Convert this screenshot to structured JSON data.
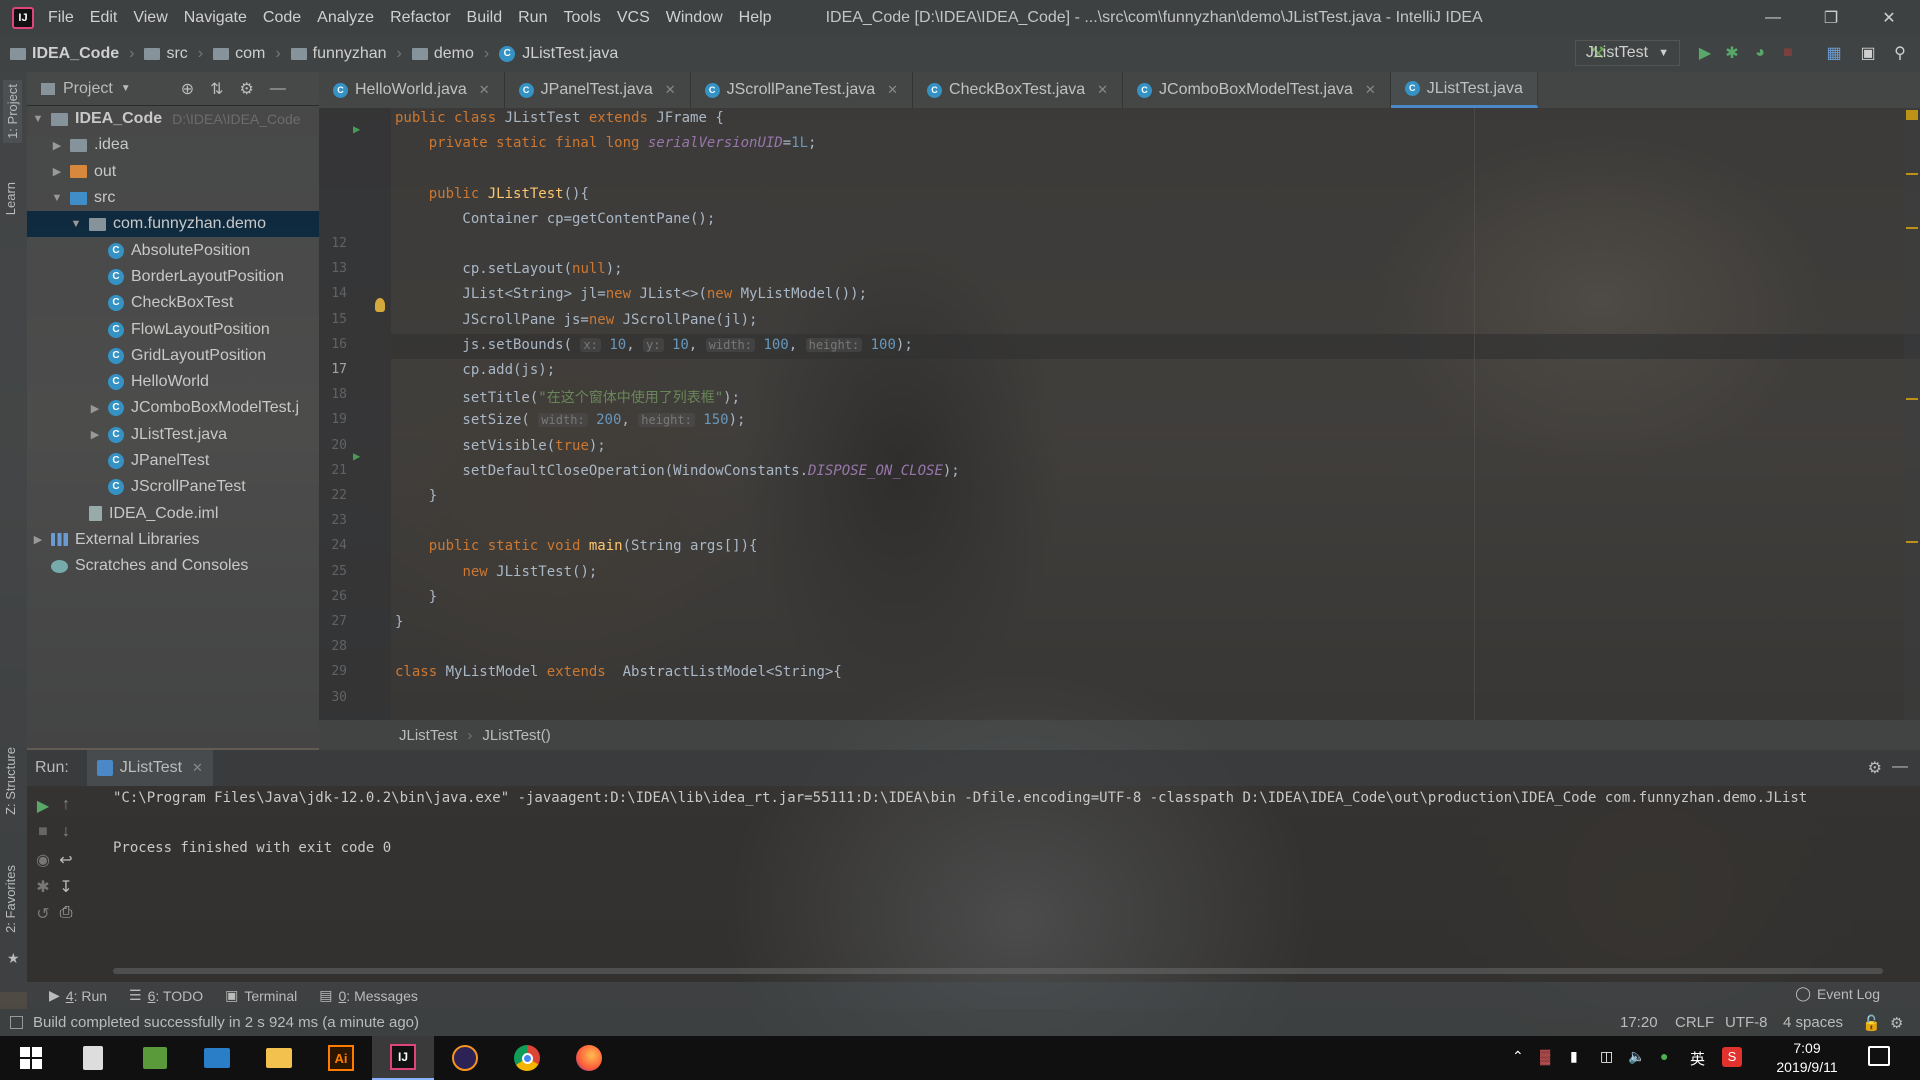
{
  "app": {
    "window_title": "IDEA_Code [D:\\IDEA\\IDEA_Code] - ...\\src\\com\\funnyzhan\\demo\\JListTest.java - IntelliJ IDEA"
  },
  "menu": [
    "File",
    "Edit",
    "View",
    "Navigate",
    "Code",
    "Analyze",
    "Refactor",
    "Build",
    "Run",
    "Tools",
    "VCS",
    "Window",
    "Help"
  ],
  "breadcrumb": [
    "IDEA_Code",
    "src",
    "com",
    "funnyzhan",
    "demo",
    "JListTest.java"
  ],
  "run_config": "JListTest",
  "left_strip": {
    "project": "1: Project",
    "learn": "Learn",
    "structure": "Z: Structure",
    "favorites": "2: Favorites"
  },
  "project_pane": {
    "title": "Project",
    "items": [
      {
        "label": "IDEA_Code",
        "hint": "D:\\IDEA\\IDEA_Code",
        "type": "module",
        "depth": 0,
        "expanded": true
      },
      {
        "label": ".idea",
        "type": "folder",
        "depth": 1,
        "expanded": false
      },
      {
        "label": "out",
        "type": "folder-orange",
        "depth": 1,
        "expanded": false
      },
      {
        "label": "src",
        "type": "folder-blue",
        "depth": 1,
        "expanded": true
      },
      {
        "label": "com.funnyzhan.demo",
        "type": "package",
        "depth": 2,
        "expanded": true,
        "selected": true
      },
      {
        "label": "AbsolutePosition",
        "type": "class",
        "depth": 3
      },
      {
        "label": "BorderLayoutPosition",
        "type": "class",
        "depth": 3
      },
      {
        "label": "CheckBoxTest",
        "type": "class",
        "depth": 3
      },
      {
        "label": "FlowLayoutPosition",
        "type": "class",
        "depth": 3
      },
      {
        "label": "GridLayoutPosition",
        "type": "class",
        "depth": 3
      },
      {
        "label": "HelloWorld",
        "type": "class",
        "depth": 3
      },
      {
        "label": "JComboBoxModelTest.j",
        "type": "class",
        "depth": 3,
        "collapsed": true
      },
      {
        "label": "JListTest.java",
        "type": "class",
        "depth": 3,
        "collapsed": true
      },
      {
        "label": "JPanelTest",
        "type": "class",
        "depth": 3
      },
      {
        "label": "JScrollPaneTest",
        "type": "class",
        "depth": 3
      },
      {
        "label": "IDEA_Code.iml",
        "type": "iml",
        "depth": 2
      },
      {
        "label": "External Libraries",
        "type": "lib",
        "depth": 0,
        "collapsed": true
      },
      {
        "label": "Scratches and Consoles",
        "type": "scratch",
        "depth": 0
      }
    ]
  },
  "tabs": [
    {
      "label": "HelloWorld.java",
      "active": false
    },
    {
      "label": "JPanelTest.java",
      "active": false
    },
    {
      "label": "JScrollPaneTest.java",
      "active": false
    },
    {
      "label": "CheckBoxTest.java",
      "active": false
    },
    {
      "label": "JComboBoxModelTest.java",
      "active": false
    },
    {
      "label": "JListTest.java",
      "active": true
    }
  ],
  "editor": {
    "current_line": 17,
    "lines": [
      {
        "n": "",
        "html": "<span class='kw'>public class</span> JListTest <span class='kw'>extends</span> JFrame {",
        "indent": 0
      },
      {
        "n": "",
        "html": "    <span class='kw'>private static final long</span> <span class='fld'>serialVersionUID</span>=<span class='num'>1L</span>;",
        "indent": 0
      },
      {
        "n": "",
        "html": "",
        "indent": 0
      },
      {
        "n": "",
        "html": "    <span class='kw'>public</span> <span class='fn'>JListTest</span>(){",
        "indent": 0
      },
      {
        "n": "",
        "html": "        Container cp=getContentPane();",
        "indent": 0
      },
      {
        "n": "12",
        "html": "",
        "indent": 0
      },
      {
        "n": "13",
        "html": "        cp.setLayout(<span class='kw'>null</span>);",
        "indent": 0
      },
      {
        "n": "14",
        "html": "        JList&lt;String&gt; jl=<span class='kw'>new</span> JList&lt;&gt;(<span class='kw'>new</span> MyListModel());",
        "indent": 0
      },
      {
        "n": "15",
        "html": "        JScrollPane js=<span class='kw'>new</span> JScrollPane(jl);",
        "indent": 0
      },
      {
        "n": "16",
        "html": "        js.setBounds( <span class='hint'>x:</span> <span class='num'>10</span>, <span class='hint'>y:</span> <span class='num'>10</span>, <span class='hint'>width:</span> <span class='num'>100</span>, <span class='hint'>height:</span> <span class='num'>100</span>);",
        "indent": 0
      },
      {
        "n": "17",
        "html": "        cp.add(js);",
        "indent": 0
      },
      {
        "n": "18",
        "html": "        setTitle(<span class='str'>\"在这个窗体中使用了列表框\"</span>);",
        "indent": 0
      },
      {
        "n": "19",
        "html": "        setSize( <span class='hint'>width:</span> <span class='num'>200</span>, <span class='hint'>height:</span> <span class='num'>150</span>);",
        "indent": 0
      },
      {
        "n": "20",
        "html": "        setVisible(<span class='kw'>true</span>);",
        "indent": 0
      },
      {
        "n": "21",
        "html": "        setDefaultCloseOperation(WindowConstants.<span class='fld'>DISPOSE_ON_CLOSE</span>);",
        "indent": 0
      },
      {
        "n": "22",
        "html": "    }",
        "indent": 0
      },
      {
        "n": "23",
        "html": "",
        "indent": 0
      },
      {
        "n": "24",
        "html": "    <span class='kw'>public static void</span> <span class='fn'>main</span>(String args[]){",
        "indent": 0
      },
      {
        "n": "25",
        "html": "        <span class='kw'>new</span> JListTest();",
        "indent": 0
      },
      {
        "n": "26",
        "html": "    }",
        "indent": 0
      },
      {
        "n": "27",
        "html": "}",
        "indent": 0
      },
      {
        "n": "28",
        "html": "",
        "indent": 0
      },
      {
        "n": "29",
        "html": "<span class='kw'>class</span> MyListModel <span class='kw'>extends</span>  AbstractListModel&lt;String&gt;{",
        "indent": 0
      },
      {
        "n": "30",
        "html": "",
        "indent": 0
      }
    ]
  },
  "editor_breadcrumb": [
    "JListTest",
    "JListTest()"
  ],
  "run": {
    "label": "Run:",
    "tab": "JListTest",
    "console": [
      "\"C:\\Program Files\\Java\\jdk-12.0.2\\bin\\java.exe\" -javaagent:D:\\IDEA\\lib\\idea_rt.jar=55111:D:\\IDEA\\bin -Dfile.encoding=UTF-8 -classpath D:\\IDEA\\IDEA_Code\\out\\production\\IDEA_Code com.funnyzhan.demo.JList",
      "",
      "Process finished with exit code 0"
    ]
  },
  "bottom_tabs": [
    {
      "num": "4",
      "label": ": Run"
    },
    {
      "num": "6",
      "label": ": TODO"
    },
    {
      "num": "",
      "label": "Terminal"
    },
    {
      "num": "0",
      "label": ": Messages"
    }
  ],
  "event_log": "Event Log",
  "status": {
    "message": "Build completed successfully in 2 s 924 ms (a minute ago)",
    "position": "17:20",
    "line_sep": "CRLF",
    "encoding": "UTF-8",
    "indent": "4 spaces"
  },
  "taskbar": {
    "time": "7:09",
    "date": "2019/9/11",
    "ime": "英"
  }
}
